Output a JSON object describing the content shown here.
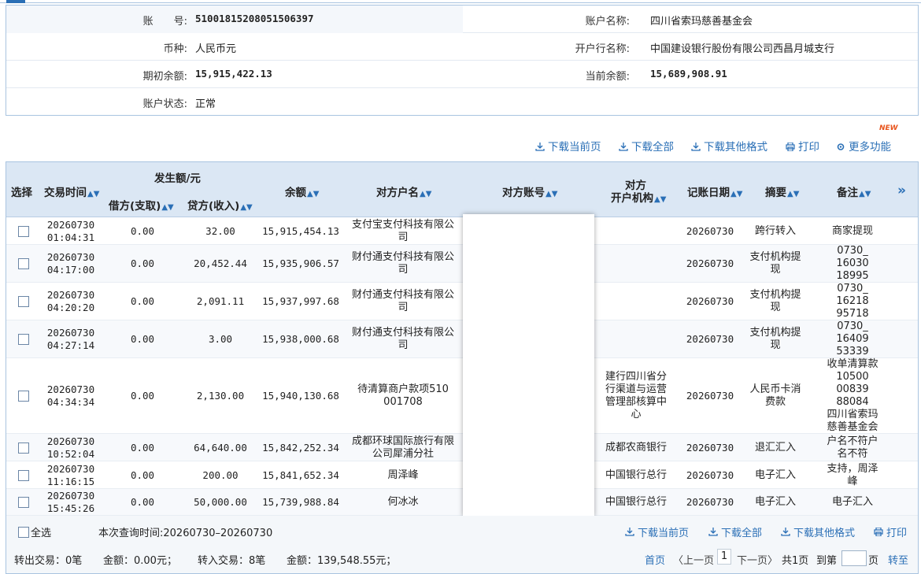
{
  "account": {
    "no_label": "账　　号:",
    "no_value": "51001815208051506397",
    "name_label": "账户名称:",
    "name_value": "四川省索玛慈善基金会",
    "currency_label": "币种:",
    "currency_value": "人民币元",
    "bank_label": "开户行名称:",
    "bank_value": "中国建设银行股份有限公司西昌月城支行",
    "opening_balance_label": "期初余额:",
    "opening_balance_value": "15,915,422.13",
    "current_balance_label": "当前余额:",
    "current_balance_value": "15,689,908.91",
    "status_label": "账户状态:",
    "status_value": "正常"
  },
  "toolbar": {
    "download_page": "下载当前页",
    "download_all": "下载全部",
    "download_other": "下载其他格式",
    "print": "打印",
    "more": "更多功能",
    "new_badge": "NEW"
  },
  "table": {
    "headers": {
      "select": "选择",
      "time": "交易时间",
      "amount_group": "发生额/元",
      "debit": "借方(支取)",
      "credit": "贷方(收入)",
      "balance": "余额",
      "counterparty": "对方户名",
      "counter_account": "对方账号",
      "counter_bank_1": "对方",
      "counter_bank_2": "开户机构",
      "post_date": "记账日期",
      "summary": "摘要",
      "remark": "备注",
      "more": "»"
    },
    "rows": [
      {
        "date": "20260730",
        "time": "01:04:31",
        "debit": "0.00",
        "credit": "32.00",
        "balance": "15,915,454.13",
        "counterparty": [
          "支付宝支付科技有限公",
          "司"
        ],
        "bank": [],
        "post_date": "20260730",
        "summary": [
          "跨行转入"
        ],
        "remark": [
          "商家提现"
        ]
      },
      {
        "date": "20260730",
        "time": "04:17:00",
        "debit": "0.00",
        "credit": "20,452.44",
        "balance": "15,935,906.57",
        "counterparty": [
          "财付通支付科技有限公",
          "司"
        ],
        "bank": [],
        "post_date": "20260730",
        "summary": [
          "支付机构提",
          "现"
        ],
        "remark": [
          "0730_",
          "16030",
          "18995"
        ]
      },
      {
        "date": "20260730",
        "time": "04:20:20",
        "debit": "0.00",
        "credit": "2,091.11",
        "balance": "15,937,997.68",
        "counterparty": [
          "财付通支付科技有限公",
          "司"
        ],
        "bank": [],
        "post_date": "20260730",
        "summary": [
          "支付机构提",
          "现"
        ],
        "remark": [
          "0730_",
          "16218",
          "95718"
        ]
      },
      {
        "date": "20260730",
        "time": "04:27:14",
        "debit": "0.00",
        "credit": "3.00",
        "balance": "15,938,000.68",
        "counterparty": [
          "财付通支付科技有限公",
          "司"
        ],
        "bank": [],
        "post_date": "20260730",
        "summary": [
          "支付机构提",
          "现"
        ],
        "remark": [
          "0730_",
          "16409",
          "53339"
        ]
      },
      {
        "date": "20260730",
        "time": "04:34:34",
        "debit": "0.00",
        "credit": "2,130.00",
        "balance": "15,940,130.68",
        "counterparty": [
          "待清算商户款项510",
          "001708"
        ],
        "bank": [
          "建行四川省分",
          "行渠道与运营",
          "管理部核算中",
          "心"
        ],
        "post_date": "20260730",
        "summary": [
          "人民币卡消",
          "费款"
        ],
        "remark": [
          "收单清算款",
          "10500",
          "00839",
          "88084",
          "四川省索玛",
          "慈善基金会"
        ]
      },
      {
        "date": "20260730",
        "time": "10:52:04",
        "debit": "0.00",
        "credit": "64,640.00",
        "balance": "15,842,252.34",
        "counterparty": [
          "成都环球国际旅行有限",
          "公司犀浦分社"
        ],
        "bank": [
          "成都农商银行"
        ],
        "post_date": "20260730",
        "summary": [
          "退汇汇入"
        ],
        "remark": [
          "户名不符户",
          "名不符"
        ]
      },
      {
        "date": "20260730",
        "time": "11:16:15",
        "debit": "0.00",
        "credit": "200.00",
        "balance": "15,841,652.34",
        "counterparty": [
          "周泽峰"
        ],
        "bank": [
          "中国银行总行"
        ],
        "post_date": "20260730",
        "summary": [
          "电子汇入"
        ],
        "remark": [
          "支持，周泽",
          "峰"
        ]
      },
      {
        "date": "20260730",
        "time": "15:45:26",
        "debit": "0.00",
        "credit": "50,000.00",
        "balance": "15,739,988.84",
        "counterparty": [
          "何冰冰"
        ],
        "bank": [
          "中国银行总行"
        ],
        "post_date": "20260730",
        "summary": [
          "电子汇入"
        ],
        "remark": [
          "电子汇入"
        ]
      }
    ]
  },
  "footer": {
    "select_all": "全选",
    "query_time": "本次查询时间:20260730–20260730",
    "download_page": "下载当前页",
    "download_all": "下载全部",
    "download_other": "下载其他格式",
    "print": "打印",
    "out_tx": "转出交易：0笔",
    "out_amount": "金额：0.00元；",
    "in_tx": "转入交易：8笔",
    "in_amount": "金额：139,548.55元；",
    "first": "首页",
    "prev": "〈上一页",
    "current_page": "1",
    "next": "下一页〉",
    "total": "共1页",
    "goto_label": "到第",
    "page_unit": "页",
    "go": "转至"
  },
  "colors": {
    "accent": "#2a6fb6",
    "header_bg": "#dbe7f4",
    "border": "#a9c4e0",
    "new_badge": "#e8541c"
  }
}
